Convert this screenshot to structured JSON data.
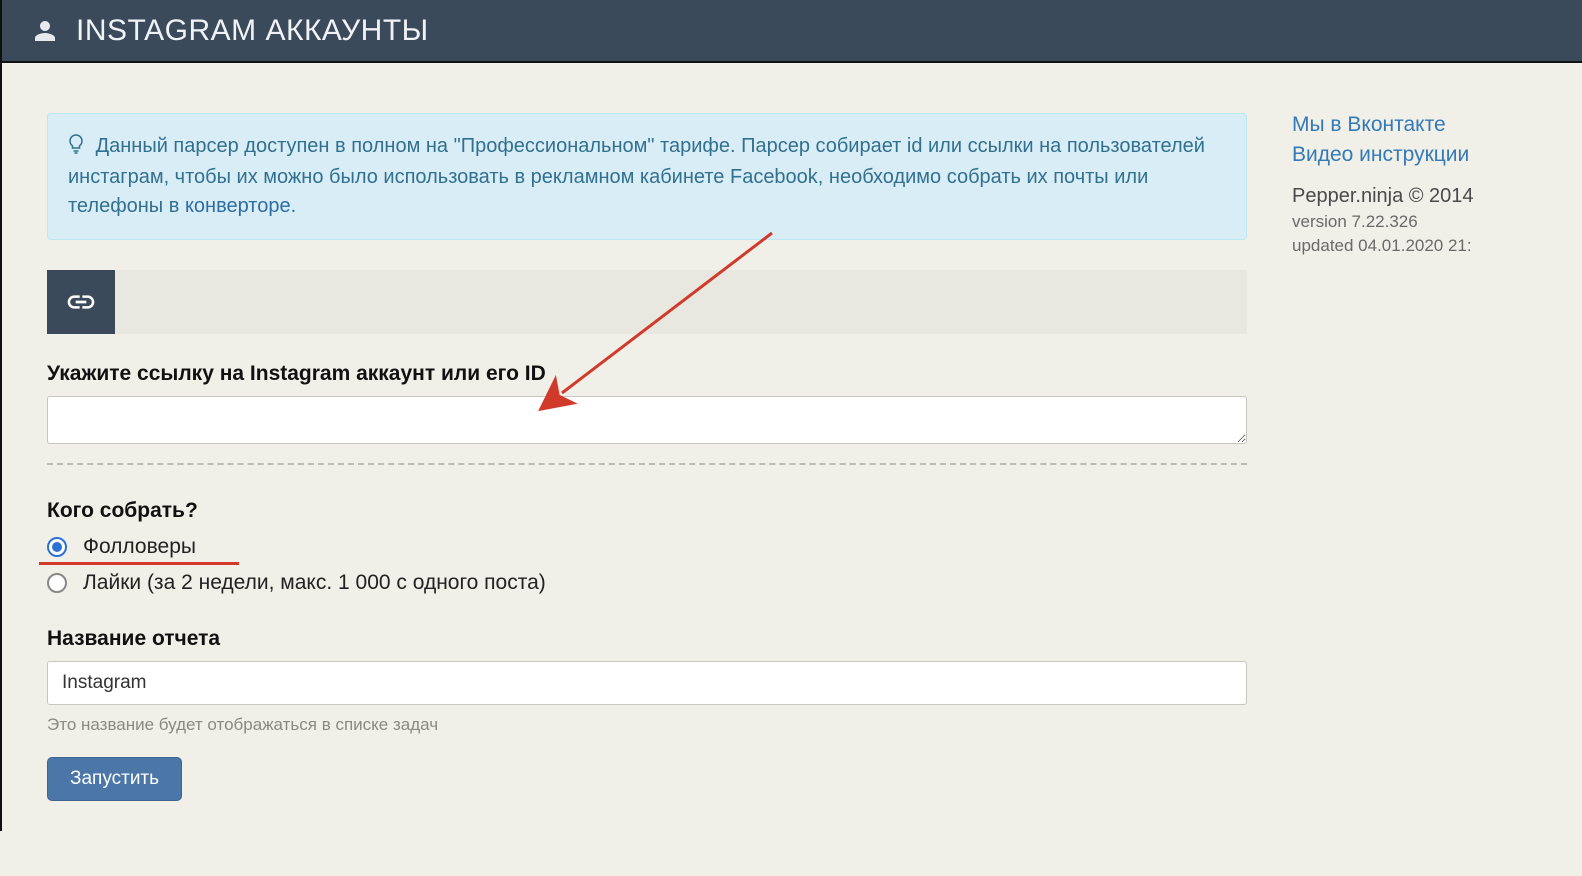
{
  "header": {
    "title": "INSTAGRAM АККАУНТЫ"
  },
  "info": {
    "text_lead": "Данный парсер доступен в полном на \"Профессиональном\" тарифе. Парсер собирает id или ссылки на пользователей инстаграм, чтобы их можно было использовать в рекламном кабинете Facebook, необходимо собрать их почты или телефоны в ",
    "link_text": "конверторе",
    "text_tail": "."
  },
  "form": {
    "url_label": "Укажите ссылку на Instagram аккаунт или его ID",
    "url_value": "",
    "collect_label": "Кого собрать?",
    "options": {
      "followers": "Фолловеры",
      "likes": "Лайки (за 2 недели, макс. 1 000 с одного поста)"
    },
    "selected_option": "followers",
    "report_label": "Название отчета",
    "report_value": "Instagram",
    "report_help": "Это название будет отображаться в списке задач",
    "run_label": "Запустить"
  },
  "sidebar": {
    "links": {
      "vk": "Мы в Вконтакте",
      "video": "Видео инструкции"
    },
    "copyright": "Pepper.ninja © 2014",
    "version": "version 7.22.326",
    "updated": "updated 04.01.2020 21:"
  }
}
